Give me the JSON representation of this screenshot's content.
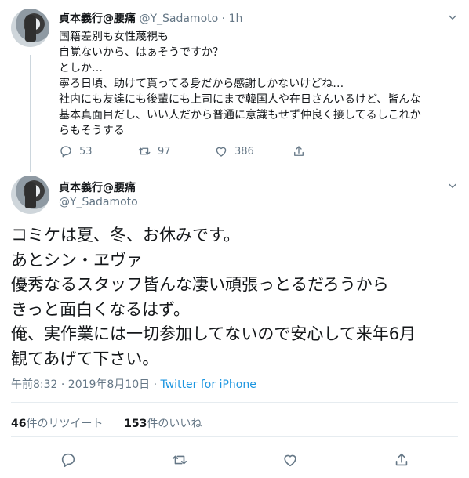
{
  "tweet1": {
    "name": "貞本義行@腰痛",
    "handle": "@Y_Sadamoto",
    "separator": "·",
    "time": "1h",
    "lines": [
      "国籍差別も女性蔑視も",
      "自覚ないから、はぁそうですか？",
      "としか…",
      "寧ろ日頃、助けて貰ってる身だから感謝しかないけどね…",
      "社内にも友達にも後輩にも上司にまで韓国人や在日さんいるけど、皆んな",
      "基本真面目だし、いい人だから普通に意識もせず仲良く接してるしこれか",
      "らもそうする"
    ],
    "reply_count": "53",
    "retweet_count": "97",
    "like_count": "386"
  },
  "tweet2": {
    "name": "貞本義行@腰痛",
    "handle": "@Y_Sadamoto",
    "lines": [
      "コミケは夏、冬、お休みです。",
      "あとシン・ヱヴァ",
      "優秀なるスタッフ皆んな凄い頑張っとるだろうから",
      "きっと面白くなるはず。",
      "俺、実作業には一切参加してないので安心して来年6月",
      "観てあげて下さい。"
    ],
    "timestamp": "午前8:32 · 2019年8月10日 · ",
    "source": "Twitter for iPhone",
    "retweets_num": "46",
    "retweets_label": "件のリツイート",
    "likes_num": "153",
    "likes_label": "件のいいね"
  },
  "icons": {
    "reply": "reply-icon",
    "retweet": "retweet-icon",
    "like": "heart-icon",
    "share": "share-icon",
    "menu": "chevron-down-icon"
  },
  "colors": {
    "text": "#14171a",
    "muted": "#657786",
    "link": "#1b95e0",
    "divider": "#e6ecf0"
  }
}
